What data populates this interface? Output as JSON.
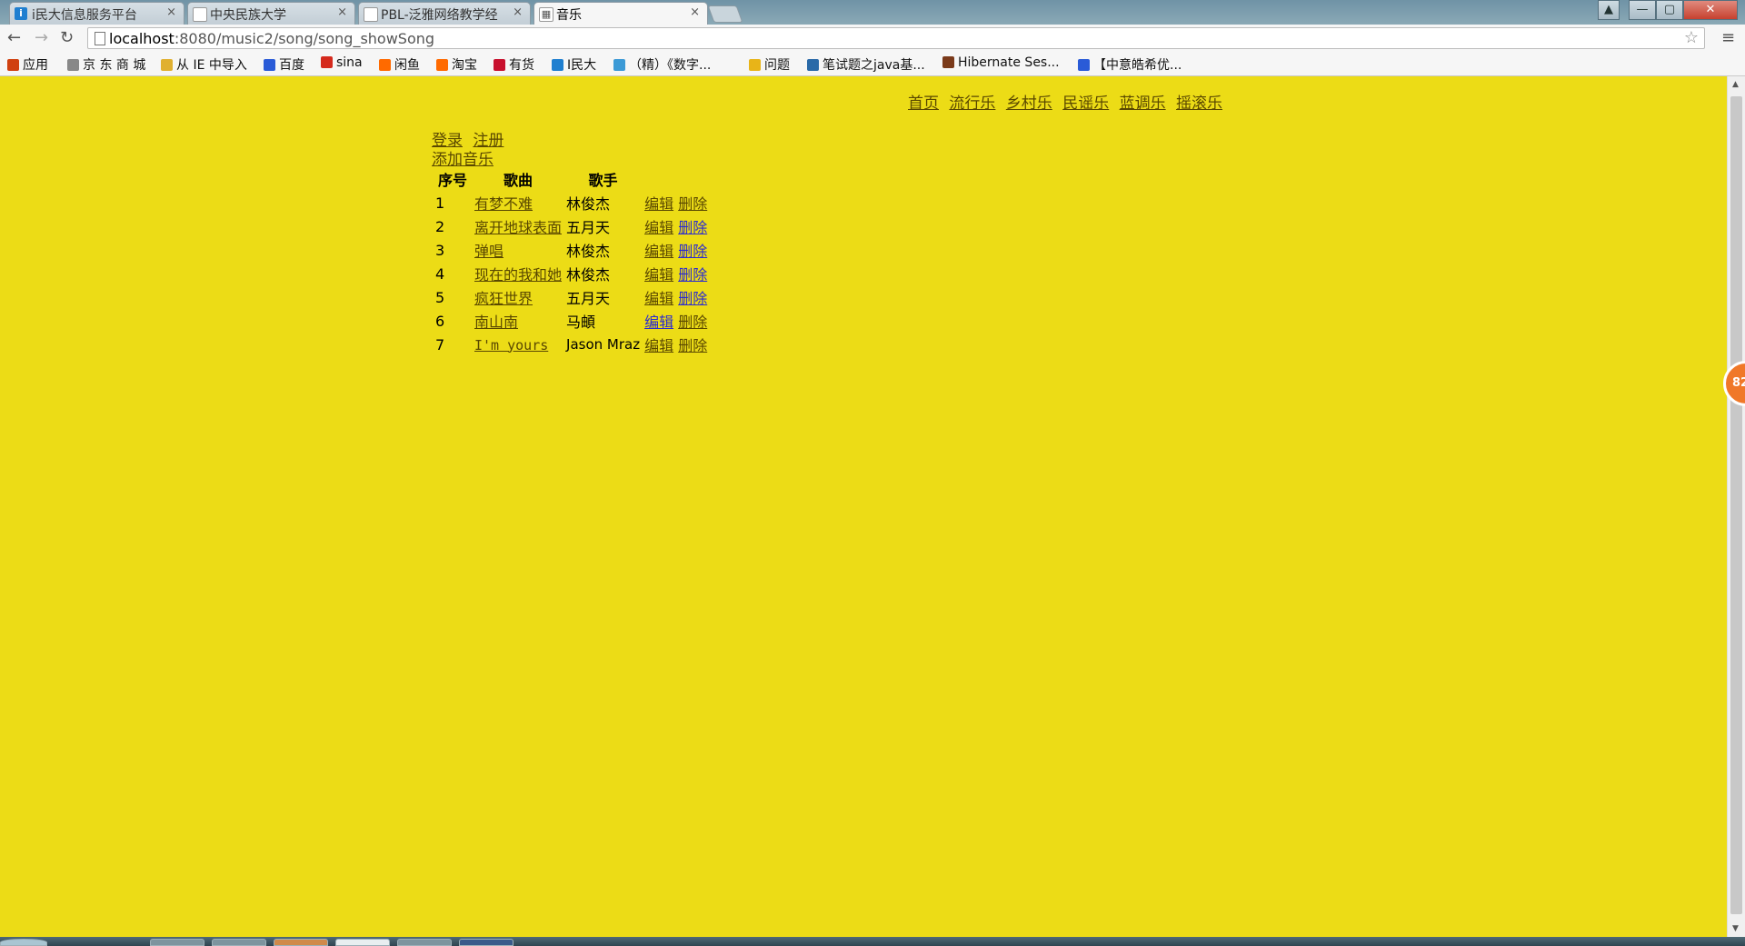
{
  "browser": {
    "tabs": [
      {
        "title": "i民大信息服务平台",
        "favicon": "i",
        "favicon_color": "#1f7fd0"
      },
      {
        "title": "中央民族大学",
        "favicon": "□",
        "favicon_color": "#ffffff"
      },
      {
        "title": "PBL-泛雅网络教学经",
        "favicon": "□",
        "favicon_color": "#ffffff"
      },
      {
        "title": "音乐",
        "favicon": "▦",
        "favicon_color": "#ffffff"
      }
    ],
    "close_glyph": "×",
    "url_host": "localhost",
    "url_rest": ":8080/music2/song/song_showSong",
    "window_controls": {
      "minimize": "—",
      "maximize": "▢",
      "close": "✕",
      "user": "▲"
    },
    "nav": {
      "back": "←",
      "forward": "→",
      "reload": "↻"
    },
    "star": "☆",
    "menu": "≡"
  },
  "bookmarks": [
    {
      "label": "应用",
      "icon": "apps-icon",
      "color": "#d04010"
    },
    {
      "label": "京 东 商 城",
      "icon": "page-icon",
      "color": "#888888"
    },
    {
      "label": "从 IE 中导入",
      "icon": "folder-icon",
      "color": "#e0b030"
    },
    {
      "label": "百度",
      "icon": "baidu-icon",
      "color": "#2a5bd7"
    },
    {
      "label": "sina",
      "icon": "weibo-icon",
      "color": "#d52a1d"
    },
    {
      "label": "闲鱼",
      "icon": "taobao-icon",
      "color": "#ff6a00"
    },
    {
      "label": "淘宝",
      "icon": "taobao-icon",
      "color": "#ff6a00"
    },
    {
      "label": "有货",
      "icon": "yohobuy-icon",
      "color": "#c8102e"
    },
    {
      "label": "I民大",
      "icon": "i-icon",
      "color": "#1f7fd0"
    },
    {
      "label": "（精）《数字...",
      "icon": "book-icon",
      "color": "#3c9ad6"
    },
    {
      "label": "问题",
      "icon": "smile-icon",
      "color": "#e8b418"
    },
    {
      "label": "笔试题之java基...",
      "icon": "compass-icon",
      "color": "#2a6aa8"
    },
    {
      "label": "Hibernate Ses...",
      "icon": "hibernate-icon",
      "color": "#7a3a1a"
    },
    {
      "label": "【中意皓希优...",
      "icon": "baidu-icon",
      "color": "#2a5bd7"
    }
  ],
  "page": {
    "top_nav": [
      "首页",
      "流行乐",
      "乡村乐",
      "民谣乐",
      "蓝调乐",
      "摇滚乐"
    ],
    "login": "登录",
    "register": "注册",
    "add_song": "添加音乐",
    "table_headers": {
      "index": "序号",
      "song": "歌曲",
      "singer": "歌手"
    },
    "edit_label": "编辑",
    "delete_label": "删除",
    "songs": [
      {
        "index": "1",
        "song": "有梦不难",
        "singer": "林俊杰"
      },
      {
        "index": "2",
        "song": "离开地球表面",
        "singer": "五月天"
      },
      {
        "index": "3",
        "song": "弹唱",
        "singer": "林俊杰"
      },
      {
        "index": "4",
        "song": "现在的我和她",
        "singer": "林俊杰"
      },
      {
        "index": "5",
        "song": "疯狂世界",
        "singer": "五月天"
      },
      {
        "index": "6",
        "song": "南山南",
        "singer": "马頔"
      },
      {
        "index": "7",
        "song": "I'm yours",
        "singer": "Jason Mraz"
      }
    ],
    "background_color": "#ecdc16"
  },
  "side_badge": "82"
}
